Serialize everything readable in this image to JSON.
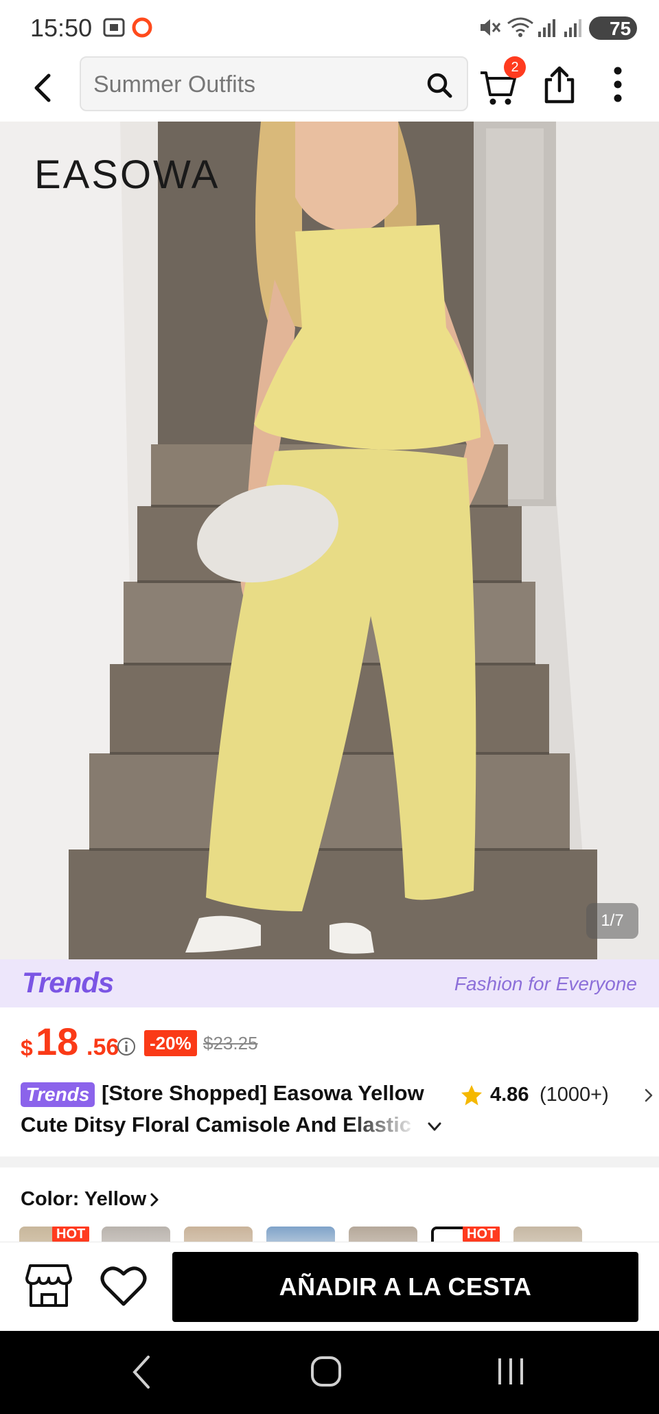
{
  "status_bar": {
    "time": "15:50",
    "battery": "75",
    "icons": [
      "screenshot-icon",
      "record-icon",
      "mute-icon",
      "wifi-icon",
      "signal-icon",
      "signal-icon",
      "battery-icon"
    ]
  },
  "search": {
    "placeholder": "Summer Outfits"
  },
  "cart": {
    "badge_count": "2"
  },
  "hero": {
    "brand_logo": "EASOWA",
    "image_counter": "1/7"
  },
  "trends_banner": {
    "logo": "Trends",
    "tagline": "Fashion for Everyone"
  },
  "price": {
    "currency": "$",
    "integer": "18",
    "decimal": ".56",
    "discount": "-20%",
    "original": "$23.25"
  },
  "product": {
    "tag": "Trends",
    "title_line1": "[Store Shopped] Easowa Yellow",
    "title_line2": "Cute Ditsy Floral Camisole And Elastic",
    "rating_score": "4.86",
    "rating_count": "(1000+)"
  },
  "color": {
    "label": "Color: Yellow",
    "hot_label": "HOT"
  },
  "actions": {
    "add_to_cart": "AÑADIR A LA CESTA"
  },
  "colors": {
    "accent": "#fa3a17",
    "trends_purple": "#8b63eb",
    "banner_bg": "#ede6fb",
    "rating_star": "#f5b800"
  }
}
